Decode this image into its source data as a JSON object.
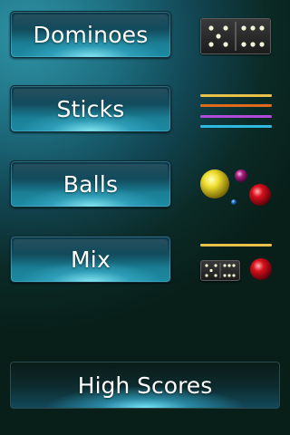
{
  "menu": {
    "dominoes_label": "Dominoes",
    "sticks_label": "Sticks",
    "balls_label": "Balls",
    "mix_label": "Mix"
  },
  "footer": {
    "high_scores_label": "High Scores"
  },
  "icons": {
    "dominoes": "domino-tiles-icon",
    "sticks": "colored-sticks-icon",
    "balls": "colored-balls-icon",
    "mix": "mixed-items-icon"
  },
  "colors": {
    "accent": "#1c8aa3",
    "glow": "#96f5ff",
    "stick_yellow": "#e8c04a",
    "stick_orange": "#e06a1c",
    "stick_purple": "#b04ad8",
    "stick_cyan": "#2fb8e0",
    "ball_yellow": "#e8d81c",
    "ball_red": "#d8101c",
    "ball_purple": "#a0207c",
    "ball_blue": "#2080e0"
  }
}
